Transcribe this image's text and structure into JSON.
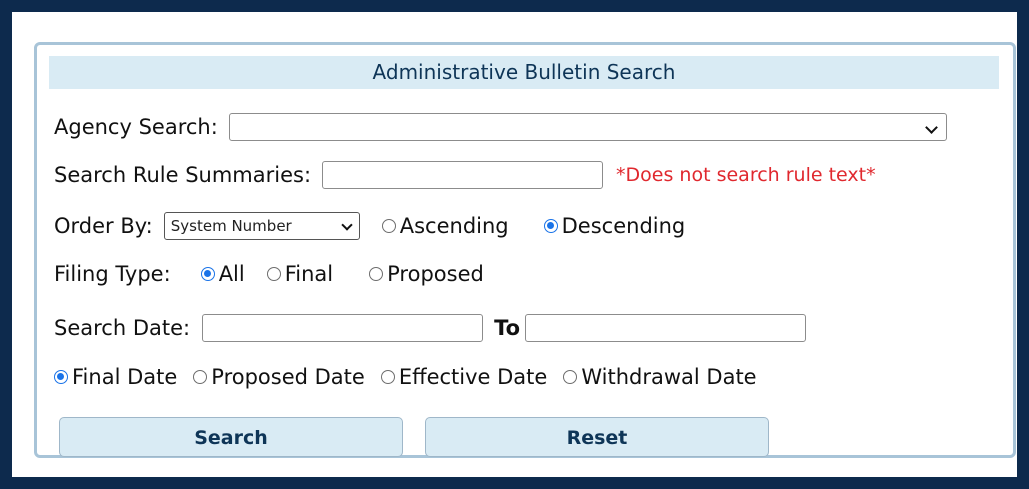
{
  "header": {
    "title": "Administrative Bulletin Search"
  },
  "agency": {
    "label": "Agency Search:",
    "value": ""
  },
  "summaries": {
    "label": "Search Rule Summaries:",
    "value": "",
    "note": "*Does not search rule text*"
  },
  "order": {
    "label": "Order By:",
    "select_value": "System Number",
    "options": [
      {
        "label": "Ascending",
        "selected": false
      },
      {
        "label": "Descending",
        "selected": true
      }
    ]
  },
  "filing": {
    "label": "Filing Type:",
    "options": [
      {
        "label": "All",
        "selected": true
      },
      {
        "label": "Final",
        "selected": false
      },
      {
        "label": "Proposed",
        "selected": false
      }
    ]
  },
  "date": {
    "label": "Search Date:",
    "to_label": "To",
    "from_value": "",
    "to_value": ""
  },
  "date_type": {
    "options": [
      {
        "label": "Final Date",
        "selected": true
      },
      {
        "label": "Proposed Date",
        "selected": false
      },
      {
        "label": "Effective Date",
        "selected": false
      },
      {
        "label": "Withdrawal Date",
        "selected": false
      }
    ]
  },
  "buttons": {
    "search": "Search",
    "reset": "Reset"
  },
  "colors": {
    "frame": "#0d2a4d",
    "header_bg": "#d9ebf4",
    "accent": "#1a73e8",
    "note": "#e0282e"
  }
}
